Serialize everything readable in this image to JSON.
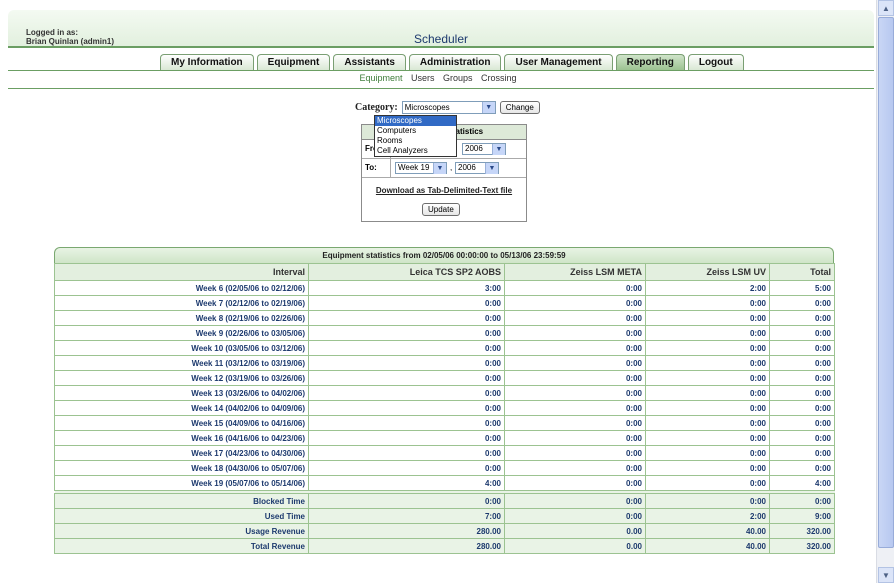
{
  "header": {
    "login_label": "Logged in as:",
    "login_user": "Brian Quinlan (admin1)",
    "title": "Scheduler"
  },
  "tabs": [
    "My Information",
    "Equipment",
    "Assistants",
    "Administration",
    "User Management",
    "Reporting",
    "Logout"
  ],
  "active_tab": "Reporting",
  "subnav": [
    "Equipment",
    "Users",
    "Groups",
    "Crossing"
  ],
  "category": {
    "label": "Category:",
    "selected": "Microscopes",
    "change_label": "Change",
    "options": [
      "Microscopes",
      "Computers",
      "Rooms",
      "Cell Analyzers"
    ]
  },
  "range": {
    "header": "Equipment statistics",
    "from_label": "From:",
    "from_year": "2006",
    "to_label": "To:",
    "to_week": "Week 19",
    "to_year": "2006",
    "download": "Download as Tab-Delimited-Text file",
    "update": "Update"
  },
  "stats": {
    "title": "Equipment statistics from 02/05/06 00:00:00 to 05/13/06 23:59:59",
    "columns": [
      "Interval",
      "Leica TCS SP2 AOBS",
      "Zeiss LSM META",
      "Zeiss LSM UV",
      "Total"
    ],
    "rows": [
      [
        "Week 6 (02/05/06 to 02/12/06)",
        "3:00",
        "0:00",
        "2:00",
        "5:00"
      ],
      [
        "Week 7 (02/12/06 to 02/19/06)",
        "0:00",
        "0:00",
        "0:00",
        "0:00"
      ],
      [
        "Week 8 (02/19/06 to 02/26/06)",
        "0:00",
        "0:00",
        "0:00",
        "0:00"
      ],
      [
        "Week 9 (02/26/06 to 03/05/06)",
        "0:00",
        "0:00",
        "0:00",
        "0:00"
      ],
      [
        "Week 10 (03/05/06 to 03/12/06)",
        "0:00",
        "0:00",
        "0:00",
        "0:00"
      ],
      [
        "Week 11 (03/12/06 to 03/19/06)",
        "0:00",
        "0:00",
        "0:00",
        "0:00"
      ],
      [
        "Week 12 (03/19/06 to 03/26/06)",
        "0:00",
        "0:00",
        "0:00",
        "0:00"
      ],
      [
        "Week 13 (03/26/06 to 04/02/06)",
        "0:00",
        "0:00",
        "0:00",
        "0:00"
      ],
      [
        "Week 14 (04/02/06 to 04/09/06)",
        "0:00",
        "0:00",
        "0:00",
        "0:00"
      ],
      [
        "Week 15 (04/09/06 to 04/16/06)",
        "0:00",
        "0:00",
        "0:00",
        "0:00"
      ],
      [
        "Week 16 (04/16/06 to 04/23/06)",
        "0:00",
        "0:00",
        "0:00",
        "0:00"
      ],
      [
        "Week 17 (04/23/06 to 04/30/06)",
        "0:00",
        "0:00",
        "0:00",
        "0:00"
      ],
      [
        "Week 18 (04/30/06 to 05/07/06)",
        "0:00",
        "0:00",
        "0:00",
        "0:00"
      ],
      [
        "Week 19 (05/07/06 to 05/14/06)",
        "4:00",
        "0:00",
        "0:00",
        "4:00"
      ]
    ],
    "summary": [
      [
        "Blocked Time",
        "0:00",
        "0:00",
        "0:00",
        "0:00"
      ],
      [
        "Used Time",
        "7:00",
        "0:00",
        "2:00",
        "9:00"
      ],
      [
        "Usage Revenue",
        "280.00",
        "0.00",
        "40.00",
        "320.00"
      ],
      [
        "Total Revenue",
        "280.00",
        "0.00",
        "40.00",
        "320.00"
      ]
    ]
  },
  "colors": {
    "accent_green": "#6b9e63",
    "dropdown_highlight": "#316ac5",
    "table_text": "#1d3a6e"
  }
}
